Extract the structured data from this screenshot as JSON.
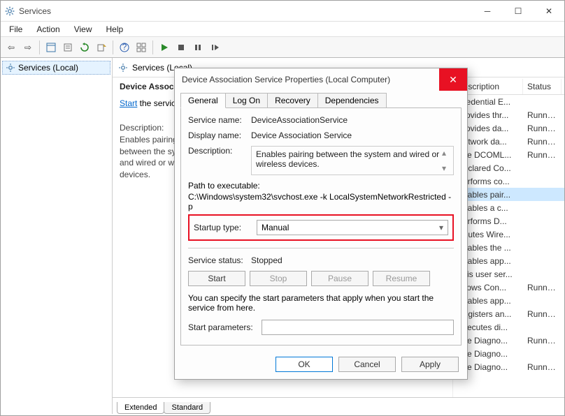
{
  "window": {
    "title": "Services"
  },
  "menu": {
    "file": "File",
    "action": "Action",
    "view": "View",
    "help": "Help"
  },
  "tree": {
    "root": "Services (Local)"
  },
  "centerHeader": "Services (Local)",
  "detail": {
    "title": "Device Association",
    "start_link": "Start",
    "start_suffix": " the service",
    "desc_label": "Description:",
    "desc_text": "Enables pairing between the system and wired or wireless devices."
  },
  "bottomTabs": {
    "extended": "Extended",
    "standard": "Standard"
  },
  "listHeaders": {
    "description": "Description",
    "status": "Status"
  },
  "rows": [
    {
      "d": "Credential E...",
      "s": ""
    },
    {
      "d": "Provides thr...",
      "s": "Running"
    },
    {
      "d": "Provides da...",
      "s": "Running"
    },
    {
      "d": "Network da...",
      "s": "Running"
    },
    {
      "d": "The DCOML...",
      "s": "Running"
    },
    {
      "d": "Declared Co...",
      "s": ""
    },
    {
      "d": "Performs co...",
      "s": ""
    },
    {
      "d": "Enables pair...",
      "s": "",
      "sel": true
    },
    {
      "d": "Enables a c...",
      "s": ""
    },
    {
      "d": "Performs D...",
      "s": ""
    },
    {
      "d": "Routes Wire...",
      "s": ""
    },
    {
      "d": "Enables the ...",
      "s": ""
    },
    {
      "d": "Enables app...",
      "s": ""
    },
    {
      "d": "This user ser...",
      "s": ""
    },
    {
      "d": "Allows Con...",
      "s": "Running"
    },
    {
      "d": "Enables app...",
      "s": ""
    },
    {
      "d": "Registers an...",
      "s": "Running"
    },
    {
      "d": "Executes di...",
      "s": ""
    },
    {
      "d": "The Diagno...",
      "s": "Running"
    },
    {
      "d": "The Diagno...",
      "s": ""
    },
    {
      "d": "The Diagno...",
      "s": "Running"
    }
  ],
  "dialog": {
    "title": "Device Association Service Properties (Local Computer)",
    "tabs": {
      "general": "General",
      "logon": "Log On",
      "recovery": "Recovery",
      "dependencies": "Dependencies"
    },
    "service_name_label": "Service name:",
    "service_name": "DeviceAssociationService",
    "display_name_label": "Display name:",
    "display_name": "Device Association Service",
    "description_label": "Description:",
    "description": "Enables pairing between the system and wired or wireless devices.",
    "path_label": "Path to executable:",
    "path": "C:\\Windows\\system32\\svchost.exe -k LocalSystemNetworkRestricted -p",
    "startup_label": "Startup type:",
    "startup_value": "Manual",
    "status_label": "Service status:",
    "status_value": "Stopped",
    "btn_start": "Start",
    "btn_stop": "Stop",
    "btn_pause": "Pause",
    "btn_resume": "Resume",
    "help_text": "You can specify the start parameters that apply when you start the service from here.",
    "start_params_label": "Start parameters:",
    "ok": "OK",
    "cancel": "Cancel",
    "apply": "Apply"
  }
}
